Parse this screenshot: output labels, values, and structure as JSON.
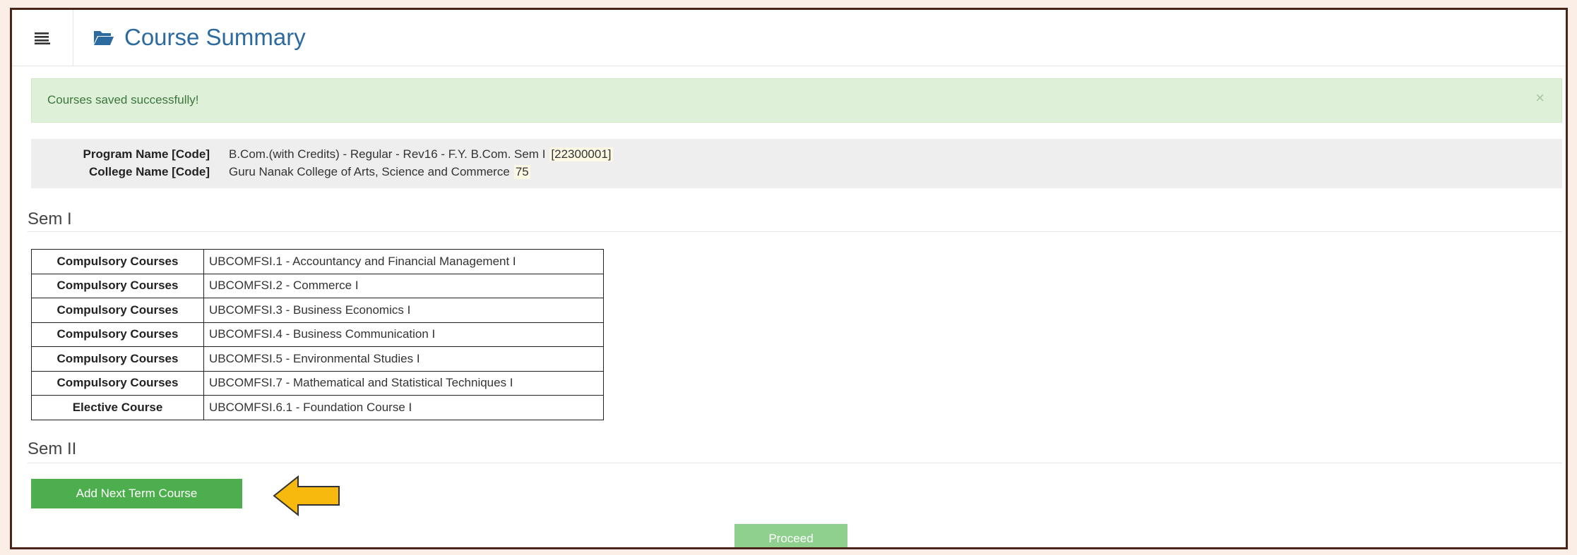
{
  "header": {
    "title": "Course Summary",
    "menu_icon": "hamburger-menu-icon",
    "title_icon": "folder-open-icon",
    "title_color": "#2c6aa0"
  },
  "alert": {
    "message": "Courses saved successfully!",
    "close": "×",
    "color": "#dff0d8"
  },
  "info": {
    "program_label": "Program Name [Code]",
    "program_value": "B.Com.(with Credits) - Regular - Rev16 - F.Y. B.Com. Sem I",
    "program_code": "[22300001]",
    "college_label": "College Name [Code]",
    "college_value": "Guru Nanak College of Arts, Science and Commerce",
    "college_code": "75"
  },
  "sem1": {
    "title": "Sem I",
    "courses": [
      {
        "type": "Compulsory Courses",
        "name": "UBCOMFSI.1 - Accountancy and Financial Management I"
      },
      {
        "type": "Compulsory Courses",
        "name": "UBCOMFSI.2 - Commerce I"
      },
      {
        "type": "Compulsory Courses",
        "name": "UBCOMFSI.3 - Business Economics I"
      },
      {
        "type": "Compulsory Courses",
        "name": "UBCOMFSI.4 - Business Communication I"
      },
      {
        "type": "Compulsory Courses",
        "name": "UBCOMFSI.5 - Environmental Studies I"
      },
      {
        "type": "Compulsory Courses",
        "name": "UBCOMFSI.7 - Mathematical and Statistical Techniques I"
      },
      {
        "type": "Elective Course",
        "name": "UBCOMFSI.6.1 - Foundation Course I"
      }
    ]
  },
  "sem2": {
    "title": "Sem II"
  },
  "actions": {
    "add_next_term": "Add Next Term Course",
    "proceed": "Proceed",
    "add_color": "#4cae4c",
    "proceed_color": "#8fd08f",
    "arrow_icon": "left-arrow-icon",
    "arrow_color": "#f8b90f"
  }
}
